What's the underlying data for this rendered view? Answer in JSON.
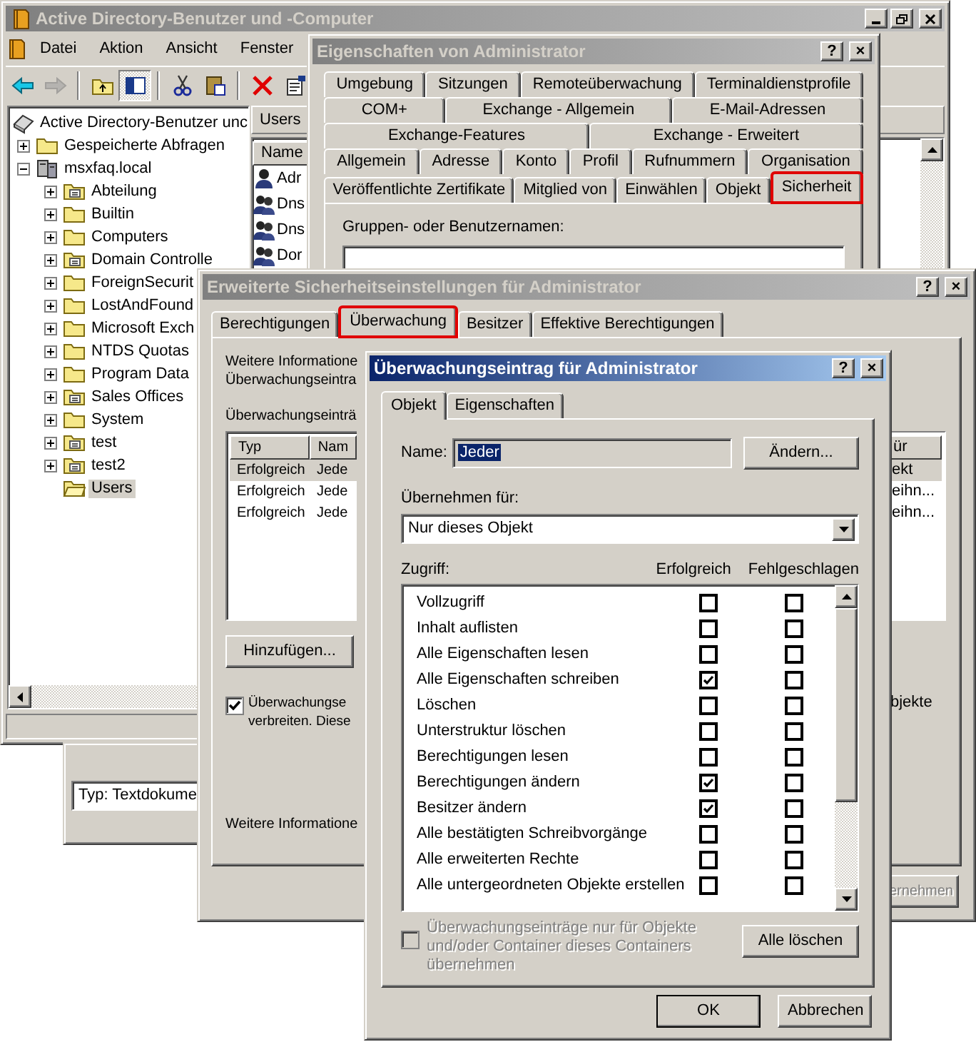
{
  "main_window": {
    "title": "Active Directory-Benutzer und -Computer",
    "active": false,
    "caption_buttons": [
      {
        "kind": "minimize"
      },
      {
        "kind": "restore"
      },
      {
        "kind": "close"
      }
    ],
    "menu": [
      "Datei",
      "Aktion",
      "Ansicht",
      "Fenster"
    ],
    "toolbar_groups": [
      [
        {
          "kind": "back",
          "disabled": false,
          "pressed": false
        },
        {
          "kind": "forward",
          "disabled": true,
          "pressed": false
        }
      ],
      [
        {
          "kind": "up",
          "disabled": false,
          "pressed": false
        },
        {
          "kind": "console_tree",
          "disabled": false,
          "pressed": true
        }
      ],
      [
        {
          "kind": "cut",
          "disabled": false,
          "pressed": false
        },
        {
          "kind": "paste",
          "disabled": false,
          "pressed": false
        }
      ],
      [
        {
          "kind": "delete",
          "disabled": false,
          "pressed": false
        },
        {
          "kind": "properties",
          "disabled": false,
          "pressed": false
        }
      ]
    ],
    "tree": {
      "label": "Active Directory-Benutzer unc",
      "kind": "snapin",
      "selected": false,
      "children": [
        {
          "label": "Gespeicherte Abfragen",
          "kind": "folder",
          "selected": false,
          "expanded": false
        },
        {
          "label": "msxfaq.local",
          "kind": "domain",
          "selected": false,
          "expanded": true,
          "children": [
            {
              "label": "Abteilung",
              "kind": "ou",
              "selected": false,
              "expanded": false
            },
            {
              "label": "Builtin",
              "kind": "folder",
              "selected": false,
              "expanded": false
            },
            {
              "label": "Computers",
              "kind": "folder",
              "selected": false,
              "expanded": false
            },
            {
              "label": "Domain Controlle",
              "kind": "ou",
              "selected": false,
              "expanded": false
            },
            {
              "label": "ForeignSecurit",
              "kind": "folder",
              "selected": false,
              "expanded": false
            },
            {
              "label": "LostAndFound",
              "kind": "folder",
              "selected": false,
              "expanded": false
            },
            {
              "label": "Microsoft Exch",
              "kind": "folder",
              "selected": false,
              "expanded": false
            },
            {
              "label": "NTDS Quotas",
              "kind": "folder",
              "selected": false,
              "expanded": false
            },
            {
              "label": "Program Data",
              "kind": "folder",
              "selected": false,
              "expanded": false
            },
            {
              "label": "Sales Offices",
              "kind": "ou",
              "selected": false,
              "expanded": false
            },
            {
              "label": "System",
              "kind": "folder",
              "selected": false,
              "expanded": false
            },
            {
              "label": "test",
              "kind": "ou",
              "selected": false,
              "expanded": false
            },
            {
              "label": "test2",
              "kind": "ou",
              "selected": false,
              "expanded": false
            },
            {
              "label": "Users",
              "kind": "open_folder",
              "selected": true
            }
          ]
        }
      ]
    },
    "pane_title": "Users",
    "list_column": "Name",
    "list_items": [
      {
        "label": "Adr",
        "kind": "user"
      },
      {
        "label": "Dns",
        "kind": "group"
      },
      {
        "label": "Dns",
        "kind": "group"
      },
      {
        "label": "Dor",
        "kind": "group"
      }
    ]
  },
  "background_window": {
    "field": "Typ: Textdokume"
  },
  "properties_dialog": {
    "title": "Eigenschaften von Administrator",
    "active": false,
    "caption_buttons": [
      {
        "kind": "help",
        "glyph": "?"
      },
      {
        "kind": "close",
        "glyph": "×"
      }
    ],
    "tab_rows": [
      [
        {
          "label": "Umgebung",
          "selected": false,
          "highlighted": false
        },
        {
          "label": "Sitzungen",
          "selected": false,
          "highlighted": false
        },
        {
          "label": "Remoteüberwachung",
          "selected": false,
          "highlighted": false
        },
        {
          "label": "Terminaldienstprofile",
          "selected": false,
          "highlighted": false
        }
      ],
      [
        {
          "label": "COM+",
          "selected": false,
          "highlighted": false
        },
        {
          "label": "Exchange - Allgemein",
          "selected": false,
          "highlighted": false
        },
        {
          "label": "E-Mail-Adressen",
          "selected": false,
          "highlighted": false
        }
      ],
      [
        {
          "label": "Exchange-Features",
          "selected": false,
          "highlighted": false
        },
        {
          "label": "Exchange - Erweitert",
          "selected": false,
          "highlighted": false
        }
      ],
      [
        {
          "label": "Allgemein",
          "selected": false,
          "highlighted": false
        },
        {
          "label": "Adresse",
          "selected": false,
          "highlighted": false
        },
        {
          "label": "Konto",
          "selected": false,
          "highlighted": false
        },
        {
          "label": "Profil",
          "selected": false,
          "highlighted": false
        },
        {
          "label": "Rufnummern",
          "selected": false,
          "highlighted": false
        },
        {
          "label": "Organisation",
          "selected": false,
          "highlighted": false
        }
      ],
      [
        {
          "label": "Veröffentlichte Zertifikate",
          "selected": false,
          "highlighted": false
        },
        {
          "label": "Mitglied von",
          "selected": false,
          "highlighted": false
        },
        {
          "label": "Einwählen",
          "selected": false,
          "highlighted": false
        },
        {
          "label": "Objekt",
          "selected": false,
          "highlighted": false
        },
        {
          "label": "Sicherheit",
          "selected": true,
          "highlighted": true
        }
      ]
    ],
    "names_label": "Gruppen- oder Benutzernamen:"
  },
  "advanced_dialog": {
    "title": "Erweiterte Sicherheitseinstellungen für Administrator",
    "active": false,
    "caption_buttons": [
      {
        "kind": "help",
        "glyph": "?"
      },
      {
        "kind": "close",
        "glyph": "×"
      }
    ],
    "tabs": [
      {
        "label": "Berechtigungen",
        "selected": false,
        "highlighted": false
      },
      {
        "label": "Überwachung",
        "selected": true,
        "highlighted": true
      },
      {
        "label": "Besitzer",
        "selected": false,
        "highlighted": false
      },
      {
        "label": "Effektive Berechtigungen",
        "selected": false,
        "highlighted": false
      }
    ],
    "info_lines": [
      "Weitere Informatione",
      "Überwachungseintra"
    ],
    "list_label": "Überwachungseinträ",
    "columns": [
      "Typ",
      "Nam"
    ],
    "column_3": "ür",
    "rows": [
      {
        "type": "Erfolgreich",
        "name": "Jede",
        "column_3": "ekt",
        "selected": true
      },
      {
        "type": "Erfolgreich",
        "name": "Jede",
        "column_3": "eihn...",
        "selected": false
      },
      {
        "type": "Erfolgreich",
        "name": "Jede",
        "column_3": "eihn...",
        "selected": false
      }
    ],
    "add_button": "Hinzufügen...",
    "inherit_checkbox": {
      "checked": true,
      "lines": [
        "Überwachungse",
        "verbreiten. Diese"
      ],
      "continuation": "bjekte"
    },
    "footer_text": "Weitere Informatione",
    "apply_button": {
      "label": "ernehmen",
      "disabled": true
    }
  },
  "audit_entry_dialog": {
    "title": "Überwachungseintrag für Administrator",
    "active": true,
    "caption_buttons": [
      {
        "kind": "help",
        "glyph": "?"
      },
      {
        "kind": "close",
        "glyph": "×"
      }
    ],
    "tabs": [
      {
        "label": "Objekt",
        "selected": true
      },
      {
        "label": "Eigenschaften",
        "selected": false
      }
    ],
    "name_label": "Name:",
    "name_field": {
      "value": "Jeder",
      "selected": true
    },
    "change_button": "Ändern...",
    "apply_label": "Übernehmen für:",
    "apply_value": "Nur dieses Objekt",
    "access_label": "Zugriff:",
    "success_heading": "Erfolgreich",
    "failure_heading": "Fehlgeschlagen",
    "permissions": [
      {
        "label": "Vollzugriff",
        "success": false,
        "failure": false
      },
      {
        "label": "Inhalt auflisten",
        "success": false,
        "failure": false
      },
      {
        "label": "Alle Eigenschaften lesen",
        "success": false,
        "failure": false
      },
      {
        "label": "Alle Eigenschaften schreiben",
        "success": true,
        "failure": false
      },
      {
        "label": "Löschen",
        "success": false,
        "failure": false
      },
      {
        "label": "Unterstruktur löschen",
        "success": false,
        "failure": false
      },
      {
        "label": "Berechtigungen lesen",
        "success": false,
        "failure": false
      },
      {
        "label": "Berechtigungen ändern",
        "success": true,
        "failure": false
      },
      {
        "label": "Besitzer ändern",
        "success": true,
        "failure": false
      },
      {
        "label": "Alle bestätigten Schreibvorgänge",
        "success": false,
        "failure": false
      },
      {
        "label": "Alle erweiterten Rechte",
        "success": false,
        "failure": false
      },
      {
        "label": "Alle untergeordneten Objekte erstellen",
        "success": false,
        "failure": false
      }
    ],
    "containers_checkbox": {
      "label": "Überwachungseinträge nur für Objekte und/oder Container dieses Containers übernehmen",
      "checked": false,
      "disabled": true
    },
    "clear_button": "Alle löschen",
    "ok_button": "OK",
    "cancel_button": "Abbrechen"
  }
}
